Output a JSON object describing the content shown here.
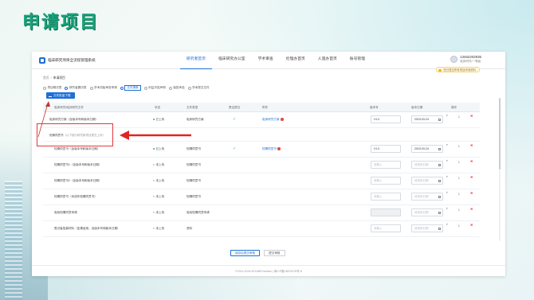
{
  "slide": {
    "title": "申请项目"
  },
  "app": {
    "name": "临床研究项目全流程管理系统"
  },
  "nav": [
    {
      "label": "研究者首页",
      "active": true
    },
    {
      "label": "临床研究办公室",
      "active": false
    },
    {
      "label": "学术审查",
      "active": false
    },
    {
      "label": "伦理办首页",
      "active": false
    },
    {
      "label": "人遗办首页",
      "active": false
    },
    {
      "label": "账号管理",
      "active": false
    }
  ],
  "user": {
    "phone": "13462202935",
    "role": "临床研究/一等级"
  },
  "notice": "您已提交所有项目申请资料",
  "breadcrumb": {
    "home": "首页",
    "separator": "/",
    "current": "申请项目"
  },
  "filters": [
    {
      "label": "项目概况表",
      "on": false
    },
    {
      "label": "研究者履历表",
      "on": true
    },
    {
      "label": "学术初始审查申请",
      "on": false
    },
    {
      "label": "文件清单",
      "on": true,
      "active": true
    },
    {
      "label": "利益冲突声明",
      "on": false
    },
    {
      "label": "保密承诺",
      "on": false
    },
    {
      "label": "学术提交文件",
      "on": false
    }
  ],
  "batch_button": "文件批量下载",
  "table": {
    "headers": [
      "临床研究/临床研究文件",
      "状态",
      "文件类型",
      "是否提交",
      "附件",
      "版本号",
      "版本日期",
      "操作"
    ],
    "rows": [
      {
        "name": "临床研究方案（含版本号和版本日期）",
        "status": "已上传",
        "status_type": "done",
        "type": "临床研究方案",
        "submitted": "✓",
        "file": "临床研究方案",
        "version": "V1.0",
        "version_ph": false,
        "date": "2023-03-24",
        "date_ph": false
      },
      {
        "name": "知情同意书（含版本号和版本日期）",
        "status": "已上传",
        "status_type": "done",
        "type": "知情同意书",
        "submitted": "✓",
        "file": "知情同意书",
        "version": "V1.0",
        "version_ph": false,
        "date": "2023-03-24",
        "date_ph": false
      },
      {
        "name": "知情同意书1（含版本号和版本日期）",
        "status": "未上传",
        "status_type": "none",
        "type": "知情同意书",
        "submitted": "",
        "file": "",
        "version": "请输入",
        "version_ph": true,
        "date": "请选择日期",
        "date_ph": true
      },
      {
        "name": "知情同意书2（含版本号和版本日期）",
        "status": "未上传",
        "status_type": "none",
        "type": "知情同意书",
        "submitted": "",
        "file": "",
        "version": "请输入",
        "version_ph": true,
        "date": "请选择日期",
        "date_ph": true
      },
      {
        "name": "知情同意书（未成年知情同意书）",
        "status": "未上传",
        "status_type": "none",
        "type": "知情同意书",
        "submitted": "",
        "file": "",
        "version": "请输入",
        "version_ph": true,
        "date": "请选择日期",
        "date_ph": true
      },
      {
        "name": "免除知情同意申请",
        "status": "未上传",
        "status_type": "none",
        "type": "免除知情同意申请",
        "submitted": "",
        "file": "",
        "version": "",
        "version_ph": true,
        "date": "请选择日期",
        "date_ph": true
      },
      {
        "name": "受试者招募材料（如果适用，含版本号和版本日期）",
        "status": "未上传",
        "status_type": "none",
        "type": "资料",
        "submitted": "",
        "file": "",
        "version": "请输入",
        "version_ph": true,
        "date": "请选择日期",
        "date_ph": true
      }
    ],
    "sub_row": {
      "name": "知情同意书",
      "hint": "（以下部分研究新项目提交上传）"
    }
  },
  "footer": {
    "save": "保存后提交审核",
    "submit": "提交审核",
    "copyright": "©2014-2024 AFLAB/Fountain  |  粤ICP备18001578号-5"
  }
}
